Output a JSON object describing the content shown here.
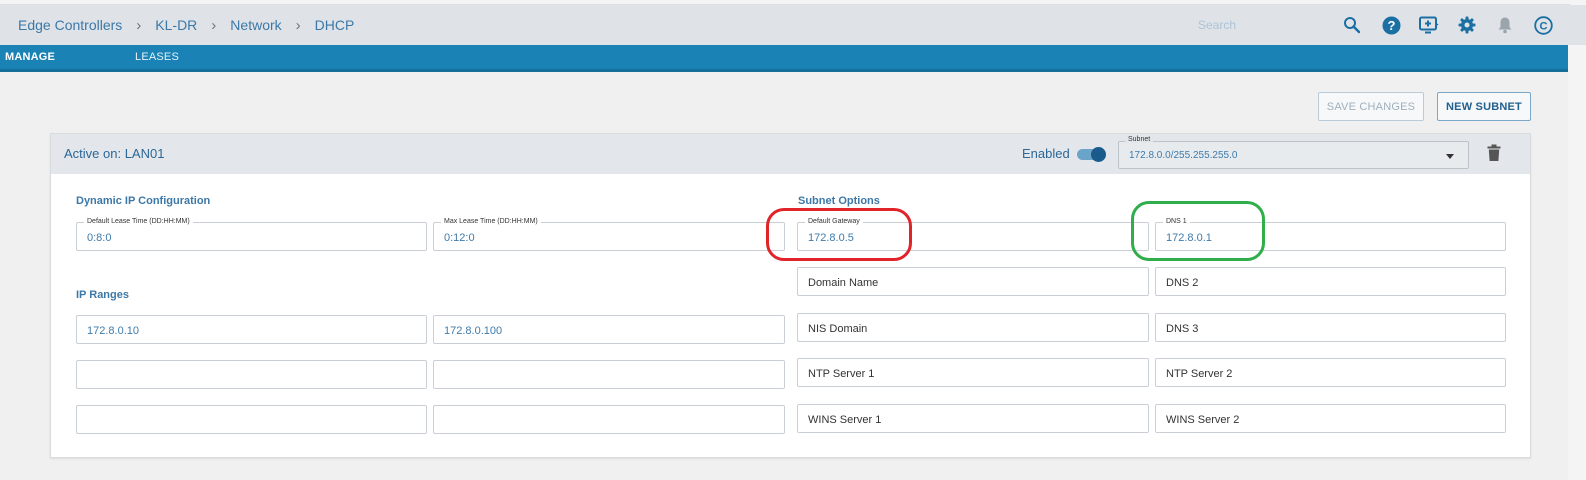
{
  "breadcrumb": [
    "Edge Controllers",
    "KL-DR",
    "Network",
    "DHCP"
  ],
  "search": {
    "placeholder": "Search"
  },
  "header_icons": [
    "search-icon",
    "help-icon",
    "screen-add-icon",
    "gear-icon",
    "bell-icon",
    "account-icon"
  ],
  "account_initial": "C",
  "tabs": {
    "manage": "MANAGE",
    "leases": "LEASES"
  },
  "actions": {
    "save": "SAVE CHANGES",
    "new_subnet": "NEW SUBNET"
  },
  "card": {
    "active_on": "Active on: LAN01",
    "enabled_label": "Enabled",
    "enabled": true,
    "subnet_legend": "Subnet",
    "subnet_value": "172.8.0.0/255.255.255.0"
  },
  "dynamic": {
    "title": "Dynamic IP Configuration",
    "default_lease_label": "Default Lease Time (DD:HH:MM)",
    "default_lease_value": "0:8:0",
    "max_lease_label": "Max Lease Time (DD:HH:MM)",
    "max_lease_value": "0:12:0"
  },
  "ip_ranges": {
    "title": "IP Ranges",
    "rows": [
      {
        "start": "172.8.0.10",
        "end": "172.8.0.100"
      },
      {
        "start": "",
        "end": ""
      },
      {
        "start": "",
        "end": ""
      }
    ]
  },
  "subnet_options": {
    "title": "Subnet Options",
    "default_gateway_label": "Default Gateway",
    "default_gateway_value": "172.8.0.5",
    "dns1_label": "DNS 1",
    "dns1_value": "172.8.0.1",
    "placeholders": {
      "domain_name": "Domain Name",
      "dns2": "DNS 2",
      "nis_domain": "NIS Domain",
      "dns3": "DNS 3",
      "ntp1": "NTP Server 1",
      "ntp2": "NTP Server 2",
      "wins1": "WINS Server 1",
      "wins2": "WINS Server 2"
    }
  },
  "colors": {
    "accent": "#1a82b5",
    "link": "#3b78a8",
    "highlight_red": "#e0242a",
    "highlight_green": "#2fae4b"
  }
}
